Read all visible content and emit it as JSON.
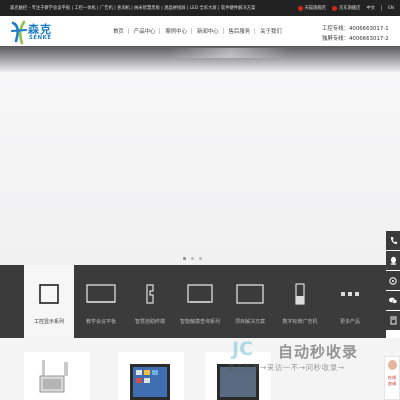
{
  "topbar": {
    "tagline": "森克触控 - 专注于教学会议平板 | 工控一体机 | 广告机 | 查询机 | 纳米智慧黑板 | 透晶拼接屏 | LED 全彩大屏 | 软件硬件解决方案",
    "tmall_label": "天猫旗舰店",
    "jd_label": "京东旗舰店",
    "lang_cn": "中文",
    "lang_en": "EN",
    "colors": {
      "tmall": "#d7261e",
      "jd": "#d7261e"
    }
  },
  "header": {
    "logo_cn": "森克",
    "logo_en": "SENKE",
    "nav": [
      {
        "label": "首页"
      },
      {
        "label": "产品中心"
      },
      {
        "label": "案例中心"
      },
      {
        "label": "新闻中心"
      },
      {
        "label": "售后服务"
      },
      {
        "label": "关于我们"
      }
    ],
    "phone_1": "工控专线：4006663017-1",
    "phone_2": "独屏专线：4006663017-2"
  },
  "hero": {
    "slides": 3,
    "active_slide": 0
  },
  "float_toolbar": {
    "icons": [
      "phone-icon",
      "qq-icon",
      "chat-icon",
      "wechat-icon",
      "up-icon"
    ]
  },
  "categories": [
    {
      "label": "工控显示系列",
      "icon": "monitor-icon",
      "active": true
    },
    {
      "label": "教学会议平板",
      "icon": "flat-panel-icon",
      "active": false
    },
    {
      "label": "智慧自助终端",
      "icon": "kiosk-icon",
      "active": false
    },
    {
      "label": "智能触摸查询系列",
      "icon": "touch-query-icon",
      "active": false
    },
    {
      "label": "项目解决方案",
      "icon": "solution-icon",
      "active": false
    },
    {
      "label": "数字标牌广告机",
      "icon": "signage-icon",
      "active": false
    },
    {
      "label": "更多产品",
      "icon": "more-icon",
      "active": false
    }
  ],
  "watermark": {
    "logo": "JC",
    "title": "自动秒收录",
    "subtitle": "森工培养→来访一不→问秒收录→"
  },
  "online_service": {
    "line1": "在线",
    "line2": "咨询"
  },
  "colors": {
    "accent": "#1d7dc7",
    "category_bar": "#3b3b3b"
  }
}
